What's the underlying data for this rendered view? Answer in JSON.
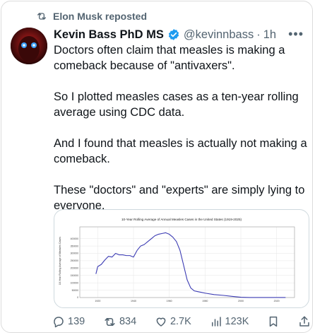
{
  "repost": {
    "label": "Elon Musk reposted"
  },
  "author": {
    "name": "Kevin Bass PhD MS",
    "handle": "@kevinnbass",
    "separator": "·",
    "time": "1h"
  },
  "tweet": {
    "paragraphs": [
      "Doctors often claim that measles is making a comeback because of \"antivaxers\".",
      "So I plotted measles cases as a ten-year rolling average using CDC data.",
      "And I found that measles is actually not making a comeback.",
      "These \"doctors\" and \"experts\" are simply lying to everyone."
    ]
  },
  "chart_data": {
    "type": "line",
    "title": "10-Year Rolling Average of Annual Measles Cases in the United States (1919-2025)",
    "ylabel": "10-Year Rolling Average of Measles Cases",
    "xlim": [
      1910,
      2030
    ],
    "ylim": [
      0,
      480000
    ],
    "xticks": [
      "1920",
      "1940",
      "1960",
      "1980",
      "2000",
      "2020"
    ],
    "yticks": [
      "0",
      "50000",
      "100000",
      "150000",
      "200000",
      "250000",
      "300000",
      "350000",
      "400000"
    ],
    "grid": true,
    "color": "#3b3bb3",
    "series": [
      {
        "x": [
          1919,
          1920,
          1922,
          1924,
          1926,
          1928,
          1930,
          1932,
          1934,
          1936,
          1938,
          1940,
          1942,
          1944,
          1946,
          1948,
          1950,
          1952,
          1954,
          1956,
          1958,
          1960,
          1962,
          1964,
          1966,
          1968,
          1970,
          1972,
          1974,
          1976,
          1978,
          1980,
          1985,
          1990,
          1995,
          2000,
          2005,
          2010,
          2015,
          2020,
          2025
        ],
        "y": [
          160000,
          210000,
          225000,
          255000,
          280000,
          275000,
          300000,
          290000,
          290000,
          285000,
          285000,
          275000,
          320000,
          350000,
          360000,
          380000,
          400000,
          420000,
          430000,
          435000,
          440000,
          430000,
          410000,
          380000,
          320000,
          220000,
          120000,
          65000,
          45000,
          40000,
          35000,
          30000,
          20000,
          15000,
          8000,
          2000,
          200,
          100,
          120,
          150,
          250
        ]
      }
    ]
  },
  "actions": {
    "reply": "139",
    "repost": "834",
    "like": "2.7K",
    "views": "123K"
  }
}
